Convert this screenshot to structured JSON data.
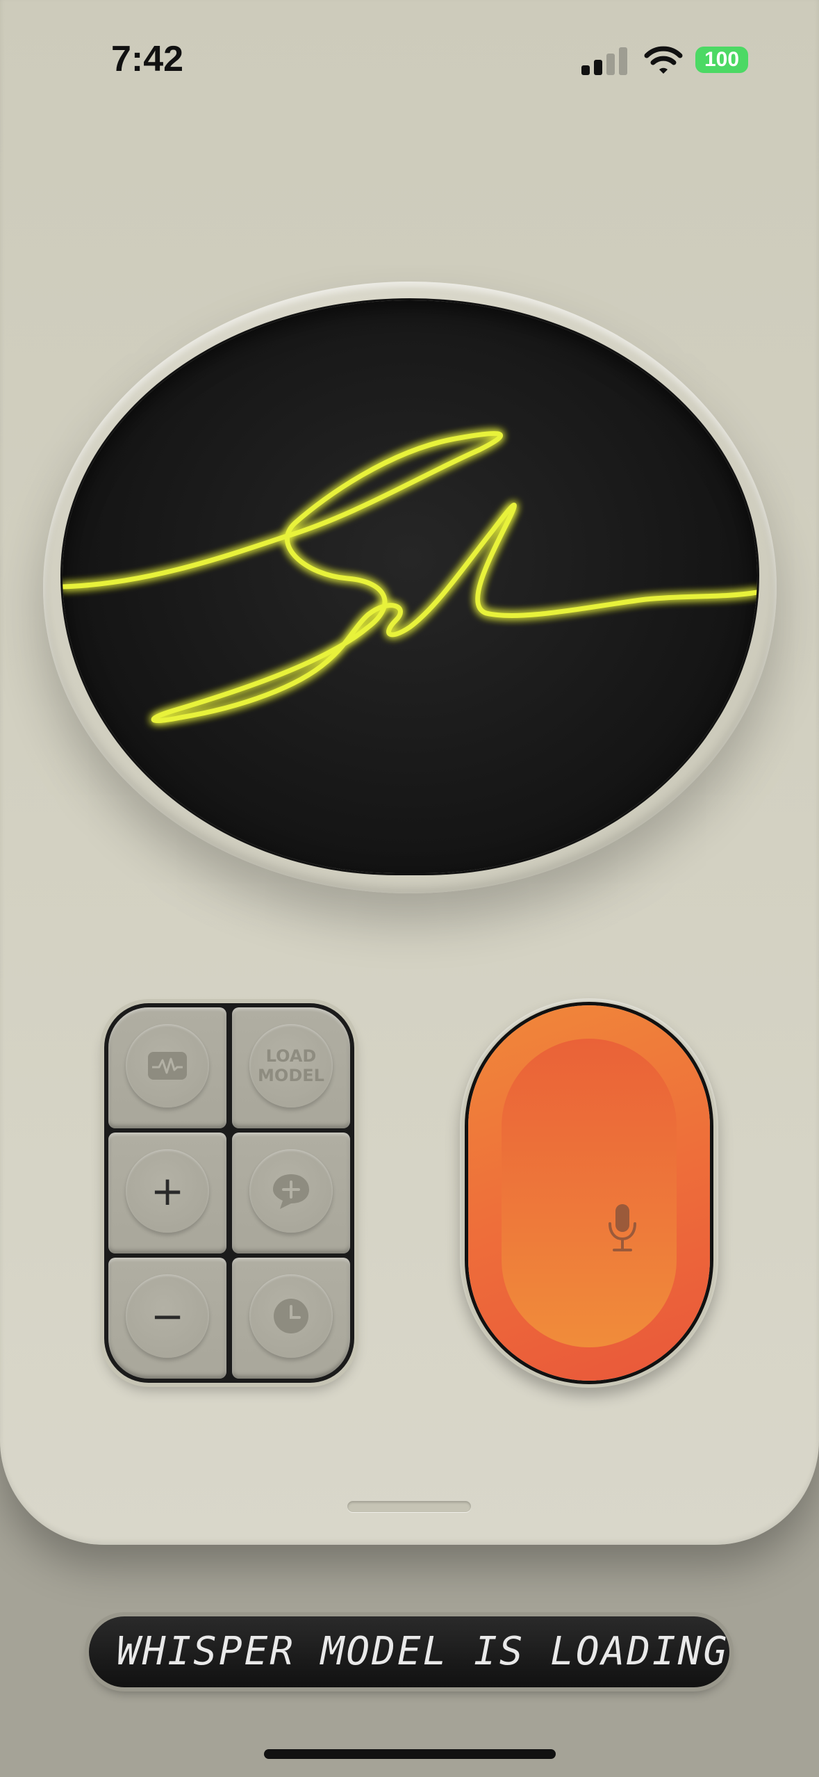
{
  "status_bar": {
    "time": "7:42",
    "battery": "100",
    "battery_color": "#4cd964"
  },
  "display": {
    "signature_text": "Sal",
    "glow_color": "#e8f23a"
  },
  "keypad": {
    "keys": [
      {
        "icon": "waveform-icon"
      },
      {
        "label": "LOAD\nMODEL"
      },
      {
        "icon": "plus-icon",
        "glyph": "+"
      },
      {
        "icon": "chat-add-icon"
      },
      {
        "icon": "minus-icon",
        "glyph": "−"
      },
      {
        "icon": "clock-icon"
      }
    ]
  },
  "record_button": {
    "icon": "microphone-icon",
    "color": "#ee6e3a"
  },
  "ticker": {
    "message": "WHISPER MODEL IS LOADING"
  }
}
